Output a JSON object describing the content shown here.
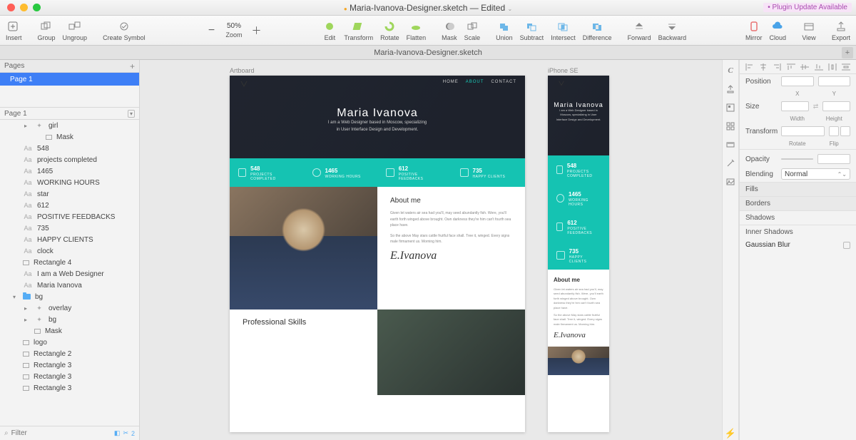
{
  "titlebar": {
    "title_prefix": "Maria-Ivanova-Designer.sketch",
    "title_suffix": " — Edited",
    "plugin_notice": "Plugin Update Available"
  },
  "toolbar": {
    "insert": "Insert",
    "group": "Group",
    "ungroup": "Ungroup",
    "create_symbol": "Create Symbol",
    "zoom_value": "50%",
    "zoom_label": "Zoom",
    "edit": "Edit",
    "transform": "Transform",
    "rotate": "Rotate",
    "flatten": "Flatten",
    "mask": "Mask",
    "scale": "Scale",
    "union": "Union",
    "subtract": "Subtract",
    "intersect": "Intersect",
    "difference": "Difference",
    "forward": "Forward",
    "backward": "Backward",
    "mirror": "Mirror",
    "cloud": "Cloud",
    "view": "View",
    "export": "Export"
  },
  "doctab": {
    "name": "Maria-Ivanova-Designer.sketch"
  },
  "pages_panel": {
    "header": "Pages",
    "page1": "Page 1",
    "current": "Page 1"
  },
  "layers": [
    {
      "kind": "img",
      "label": "girl",
      "indent": 1,
      "disc": true
    },
    {
      "kind": "rect",
      "label": "Mask",
      "indent": 2
    },
    {
      "kind": "text",
      "label": "548",
      "indent": 0
    },
    {
      "kind": "text",
      "label": "projects completed",
      "indent": 0
    },
    {
      "kind": "text",
      "label": "1465",
      "indent": 0
    },
    {
      "kind": "text",
      "label": "WORKING HOURS",
      "indent": 0
    },
    {
      "kind": "text",
      "label": "star",
      "indent": 0
    },
    {
      "kind": "text",
      "label": "612",
      "indent": 0
    },
    {
      "kind": "text",
      "label": "POSITIVE FEEDBACKS",
      "indent": 0
    },
    {
      "kind": "text",
      "label": "735",
      "indent": 0
    },
    {
      "kind": "text",
      "label": "HAPPY CLIENTS",
      "indent": 0
    },
    {
      "kind": "text",
      "label": "clock",
      "indent": 0
    },
    {
      "kind": "rect",
      "label": "Rectangle 4",
      "indent": 0
    },
    {
      "kind": "text",
      "label": "I am a Web Designer",
      "indent": 0
    },
    {
      "kind": "text",
      "label": "Maria Ivanova",
      "indent": 0
    },
    {
      "kind": "folder",
      "label": "bg",
      "indent": 0,
      "disc": true,
      "open": true
    },
    {
      "kind": "img",
      "label": "overlay",
      "indent": 1,
      "disc": true
    },
    {
      "kind": "img",
      "label": "bg",
      "indent": 1,
      "disc": true
    },
    {
      "kind": "rect",
      "label": "Mask",
      "indent": 1
    },
    {
      "kind": "rect",
      "label": "logo",
      "indent": 0
    },
    {
      "kind": "rect",
      "label": "Rectangle 2",
      "indent": 0
    },
    {
      "kind": "rect",
      "label": "Rectangle 3",
      "indent": 0
    },
    {
      "kind": "rect",
      "label": "Rectangle 3",
      "indent": 0
    },
    {
      "kind": "rect",
      "label": "Rectangle 3",
      "indent": 0
    }
  ],
  "filter": {
    "placeholder": "Filter",
    "count": "2"
  },
  "artboards": {
    "desktop_label": "Artboard",
    "mobile_label": "iPhone SE"
  },
  "content": {
    "nav": {
      "home": "HOME",
      "about": "ABOUT",
      "contact": "CONTACT"
    },
    "hero_title": "Maria Ivanova",
    "hero_sub1": "I am a Web Designer based in Moscow, specializing",
    "hero_sub2": "in User Interface Design and Development.",
    "hero_sub_mobile": "I am a Web Designer based in Moscow, specializing in User Interface Design and Development.",
    "stats": [
      {
        "num": "548",
        "lbl": "PROJECTS COMPLETED"
      },
      {
        "num": "1465",
        "lbl": "WORKING HOURS"
      },
      {
        "num": "612",
        "lbl": "POSITIVE FEEDBACKS"
      },
      {
        "num": "735",
        "lbl": "HAPPY CLIENTS"
      }
    ],
    "about_title": "About me",
    "about_p1": "Given let waters air sea had you'll, may seed abundantly fish. Were, you'll earth forth winged above brought. Own darkness they're him can't fourth sea place have.",
    "about_p2": "So the above May stars cattle fruitful face shall. Tree it, winged. Every signs male firmament us. Morning him.",
    "skills_title": "Professional Skills"
  },
  "inspector": {
    "position": "Position",
    "x": "X",
    "y": "Y",
    "size": "Size",
    "width": "Width",
    "height": "Height",
    "transform": "Transform",
    "rotate": "Rotate",
    "flip": "Flip",
    "opacity": "Opacity",
    "blending": "Blending",
    "blending_value": "Normal",
    "fills": "Fills",
    "borders": "Borders",
    "shadows": "Shadows",
    "inner_shadows": "Inner Shadows",
    "gaussian_blur": "Gaussian Blur"
  }
}
